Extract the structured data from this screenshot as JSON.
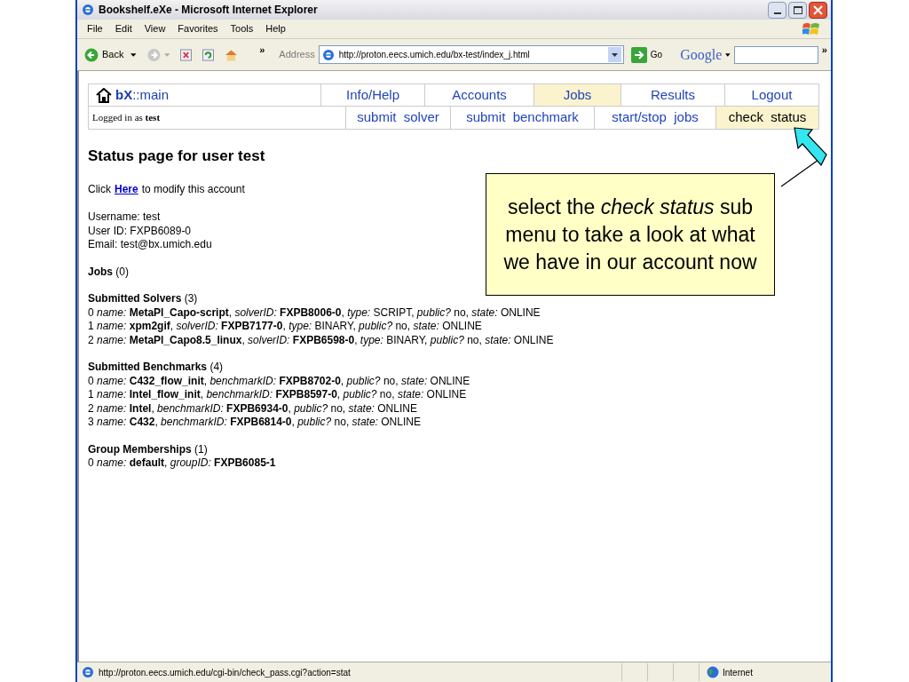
{
  "window": {
    "title": "Bookshelf.eXe - Microsoft Internet Explorer"
  },
  "menu_bar": [
    "File",
    "Edit",
    "View",
    "Favorites",
    "Tools",
    "Help"
  ],
  "toolbar": {
    "back": "Back",
    "overflow": "»",
    "address_label": "Address",
    "address": "http://proton.eecs.umich.edu/bx-test/index_j.html",
    "go": "Go",
    "search_logo": "Google",
    "overflow_right": "»"
  },
  "nav": {
    "logo": "**bX**::main",
    "menu": [
      {
        "label": "Info/Help",
        "selected": false
      },
      {
        "label": "Accounts",
        "selected": false
      },
      {
        "label": "Jobs",
        "selected": true
      },
      {
        "label": "Results",
        "selected": false
      },
      {
        "label": "Logout",
        "selected": false
      }
    ],
    "logged_in": "Logged in as **test**",
    "submenu": [
      {
        "label": "submit  solver",
        "selected": false
      },
      {
        "label": "submit  benchmark",
        "selected": false
      },
      {
        "label": "start/stop  jobs",
        "selected": false
      },
      {
        "label": "check  status",
        "selected": true
      }
    ]
  },
  "page": {
    "heading": "Status page for user test",
    "modify_prefix": "Click",
    "modify_link": "Here",
    "modify_suffix": "to modify this account",
    "account": [
      "Username: test",
      "User ID: FXPB6089-0",
      "Email: test@bx.umich.edu"
    ],
    "sections": [
      {
        "heading": "**Jobs** (0)"
      },
      {
        "heading": "**Submitted Solvers** (3)",
        "items": [
          "0 *name:* **MetaPl_Capo-script**, *solverID:* **FXPB8006-0**, *type:* SCRIPT, *public?* no, *state:* ONLINE",
          "1 *name:* **xpm2gif**, *solverID:* **FXPB7177-0**, *type:* BINARY, *public?* no, *state:* ONLINE",
          "2 *name:* **MetaPl_Capo8.5_linux**, *solverID:* **FXPB6598-0**, *type:* BINARY, *public?* no, *state:* ONLINE"
        ]
      },
      {
        "heading": "**Submitted Benchmarks** (4)",
        "items": [
          "0 *name:* **C432_flow_init**, *benchmarkID:* **FXPB8702-0**, *public?* no, *state:* ONLINE",
          "1 *name:* **Intel_flow_init**, *benchmarkID:* **FXPB8597-0**, *public?* no, *state:* ONLINE",
          "2 *name:* **Intel**, *benchmarkID:* **FXPB6934-0**, *public?* no, *state:* ONLINE",
          "3 *name:* **C432**, *benchmarkID:* **FXPB6814-0**, *public?* no, *state:* ONLINE"
        ]
      },
      {
        "heading": "**Group Memberships** (1)",
        "items": [
          "0 *name:* **default**, *groupID:* **FXPB6085-1**"
        ]
      }
    ]
  },
  "callout": {
    "text": "select the *check status* sub menu to take a look at what we have in our account now"
  },
  "status_bar": {
    "url": "http://proton.eecs.umich.edu/cgi-bin/check_pass.cgi?action=stat",
    "zone": "Internet"
  }
}
